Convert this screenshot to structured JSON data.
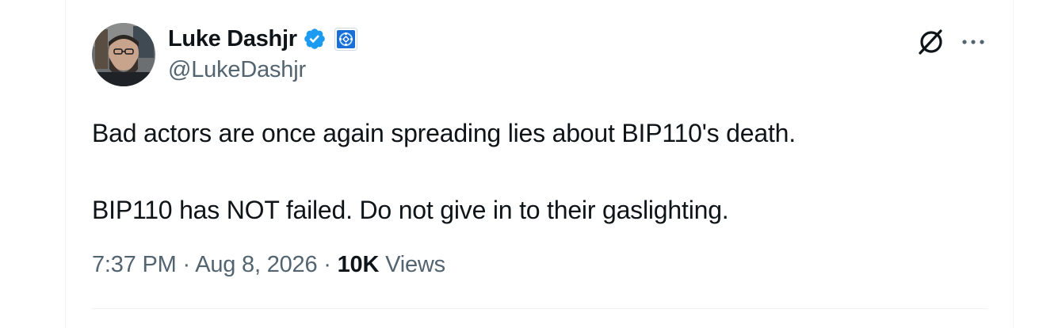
{
  "author": {
    "display_name": "Luke Dashjr",
    "handle": "@LukeDashjr",
    "verified": true,
    "verified_color": "#1d9bf0",
    "affiliate_badge": "affiliate-icon"
  },
  "tweet": {
    "lines": [
      "Bad actors are once again spreading lies about BIP110's death.",
      "BIP110 has NOT failed. Do not give in to their gaslighting."
    ]
  },
  "meta": {
    "time": "7:37 PM",
    "separator": "·",
    "date": "Aug 8, 2026",
    "views_count": "10K",
    "views_label": "Views"
  },
  "actions": {
    "grok_icon": "grok-icon",
    "more_icon": "more-icon"
  }
}
